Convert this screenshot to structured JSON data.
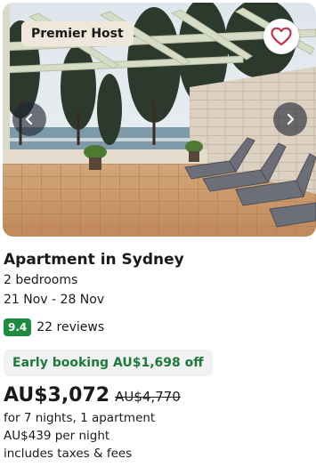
{
  "listing": {
    "badge": "Premier Host",
    "favorite_icon": "heart-outline-icon",
    "prev_icon": "chevron-left-icon",
    "next_icon": "chevron-right-icon",
    "title": "Apartment in Sydney",
    "bedrooms": "2 bedrooms",
    "dates": "21 Nov - 28 Nov",
    "rating_score": "9.4",
    "reviews": "22 reviews",
    "deal": "Early booking AU$1,698 off",
    "price": "AU$3,072",
    "original_price": "AU$4,770",
    "stay_details": "for 7 nights, 1 apartment",
    "per_night": "AU$439 per night",
    "taxes_note": "includes taxes & fees"
  },
  "colors": {
    "badge_bg": "#efe7dc",
    "heart": "#c9304a",
    "score_bg": "#1e8a3e",
    "deal_text": "#1e7a3a",
    "deal_bg": "#f2f2f2",
    "nav_bg": "#1e2332"
  }
}
